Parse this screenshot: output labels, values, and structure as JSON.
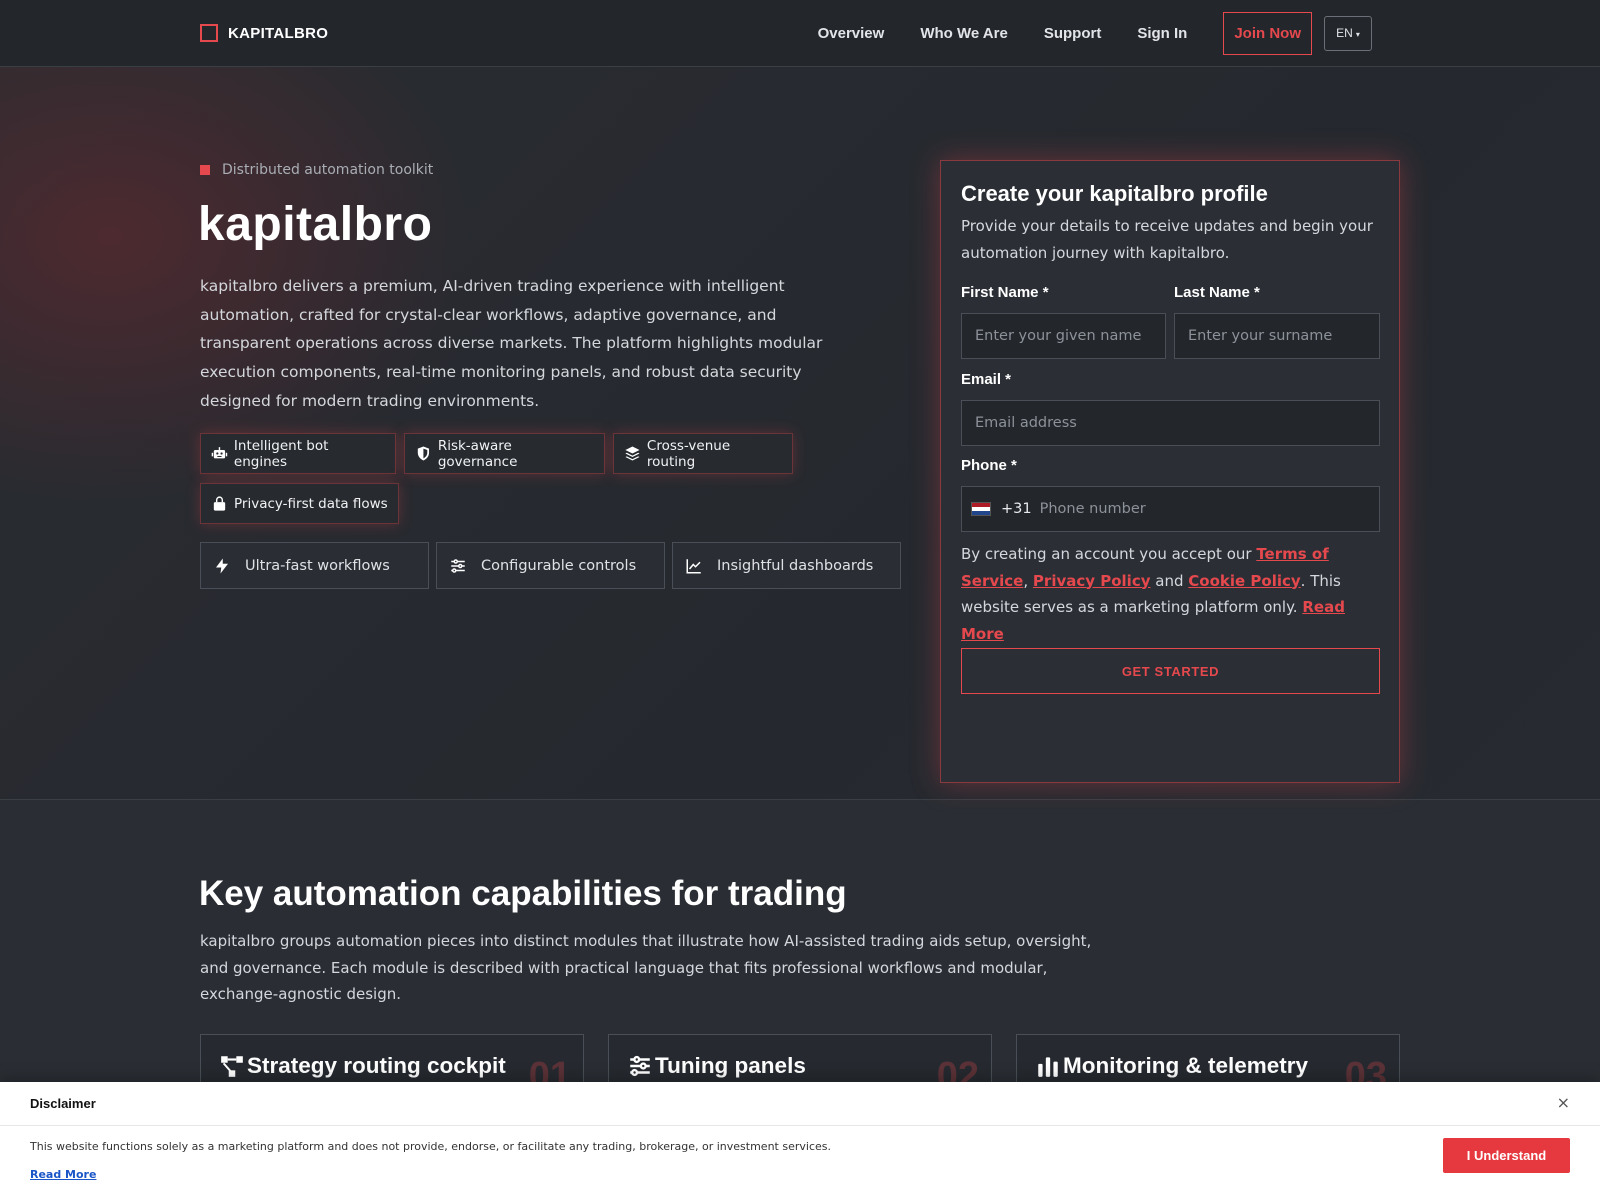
{
  "nav": {
    "brand": "KAPITALBRO",
    "links": [
      "Overview",
      "Who We Are",
      "Support",
      "Sign In"
    ],
    "join_label": "Join Now",
    "lang_label": "EN",
    "lang_icon": "caret-down-icon"
  },
  "hero": {
    "eyebrow": "Distributed automation toolkit",
    "title": "kapitalbro",
    "description": "kapitalbro delivers a premium, AI-driven trading experience with intelligent automation, crafted for crystal-clear workflows, adaptive governance, and transparent operations across diverse markets. The platform highlights modular execution components, real-time monitoring panels, and robust data security designed for modern trading environments.",
    "chips": [
      {
        "label": "Intelligent bot engines",
        "icon": "robot-icon"
      },
      {
        "label": "Risk-aware governance",
        "icon": "shield-icon"
      },
      {
        "label": "Cross-venue routing",
        "icon": "layers-icon"
      },
      {
        "label": "Privacy-first data flows",
        "icon": "lock-icon"
      }
    ],
    "features": [
      {
        "label": "Ultra-fast workflows",
        "icon": "bolt-icon"
      },
      {
        "label": "Configurable controls",
        "icon": "sliders-icon"
      },
      {
        "label": "Insightful dashboards",
        "icon": "line-chart-icon"
      }
    ]
  },
  "form": {
    "title": "Create your kapitalbro profile",
    "subtitle": "Provide your details to receive updates and begin your automation journey with kapitalbro.",
    "first_name_label": "First Name *",
    "first_name_placeholder": "Enter your given name",
    "last_name_label": "Last Name *",
    "last_name_placeholder": "Enter your surname",
    "email_label": "Email *",
    "email_placeholder": "Email address",
    "phone_label": "Phone *",
    "phone_dial_code": "+31",
    "phone_placeholder": "Phone number",
    "phone_flag_icon": "netherlands-flag-icon",
    "terms_prefix": "By creating an account you accept our ",
    "terms_link": "Terms of Service",
    "terms_sep1": ",",
    "privacy_link": "Privacy Policy",
    "terms_and": " and ",
    "cookie_link": "Cookie Policy",
    "terms_suffix": ". This website serves as a marketing platform only. ",
    "read_more": "Read More",
    "cta_label": "GET STARTED"
  },
  "capabilities": {
    "title": "Key automation capabilities for trading",
    "description": "kapitalbro groups automation pieces into distinct modules that illustrate how AI-assisted trading aids setup, oversight, and governance. Each module is described with practical language that fits professional workflows and modular, exchange-agnostic design.",
    "modules": [
      {
        "title": "Strategy routing cockpit",
        "number": "01",
        "icon": "routing-icon"
      },
      {
        "title": "Tuning panels",
        "number": "02",
        "icon": "sliders-icon"
      },
      {
        "title": "Monitoring & telemetry",
        "number": "03",
        "icon": "bar-chart-icon"
      }
    ]
  },
  "disclaimer": {
    "title": "Disclaimer",
    "close_icon": "close-icon",
    "close_glyph": "×",
    "text": "This website functions solely as a marketing platform and does not provide, endorse, or facilitate any trading, brokerage, or investment services.",
    "read_more": "Read More",
    "button_label": "I Understand"
  },
  "colors": {
    "accent": "#e5484d",
    "background": "#2a2e34",
    "nav_background": "#23272c",
    "flag_red": "#ae1c28",
    "flag_white": "#ffffff",
    "flag_blue": "#21468b"
  }
}
